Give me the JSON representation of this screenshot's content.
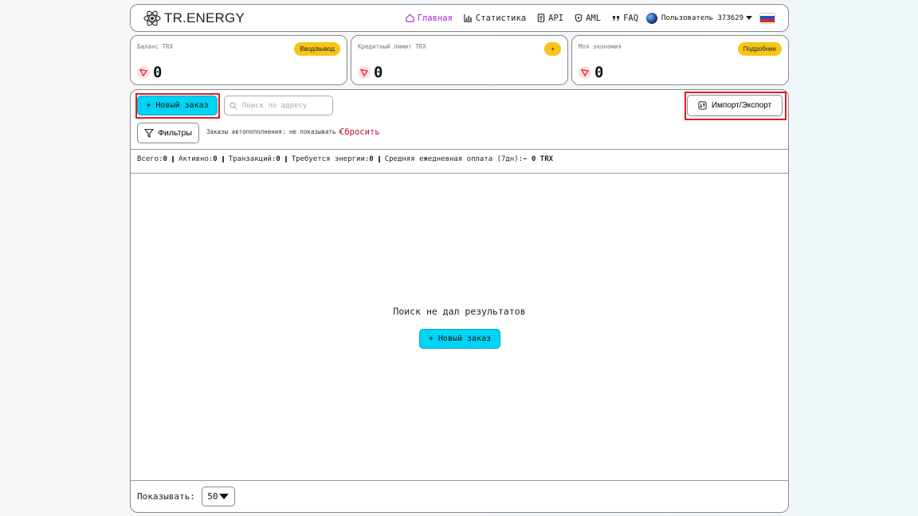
{
  "header": {
    "logo_text": "TR.ENERGY",
    "nav": [
      {
        "label": "Главная",
        "icon": "home-icon",
        "active": true
      },
      {
        "label": "Статистика",
        "icon": "bar-chart-icon",
        "active": false
      },
      {
        "label": "API",
        "icon": "document-icon",
        "active": false
      },
      {
        "label": "AML",
        "icon": "shield-icon",
        "active": false
      },
      {
        "label": "FAQ",
        "icon": "quote-icon",
        "active": false
      }
    ],
    "user_label": "Пользователь 373629",
    "language": "ru",
    "active_color": "#a623d8"
  },
  "cards": [
    {
      "label": "Баланс TRX",
      "button": "Ввод/вывод",
      "value": "0"
    },
    {
      "label": "Кредитный лимит TRX",
      "button": "+",
      "value": "0"
    },
    {
      "label": "Моя экономия",
      "button": "Подробнее",
      "value": "0"
    }
  ],
  "toolbar": {
    "new_order_label": "+ Новый заказ",
    "search_placeholder": "Поиск по адресу",
    "import_export_label": "Импорт/Экспорт",
    "filters_label": "Фильтры",
    "filter_tag": "Заказы автопополнения: не показывать",
    "filter_tag_close": "×",
    "reset_label": "Сбросить"
  },
  "stats": {
    "total_label": "Всего:",
    "total_value": "0",
    "active_label": "Активно:",
    "active_value": "0",
    "tx_label": "Транзакций:",
    "tx_value": "0",
    "energy_label": "Требуется энергии:",
    "energy_value": "0",
    "avg_label": "Средняя ежедневная оплата (7дн):",
    "avg_value": "~ 0 TRX"
  },
  "empty": {
    "message": "Поиск не дал результатов",
    "button_label": "+ Новый заказ"
  },
  "footer": {
    "show_label": "Показывать:",
    "per_page": "50"
  },
  "colors": {
    "accent_cyan": "#00d4f5",
    "card_button_yellow": "#f5c518",
    "reset_red": "#c8102e",
    "highlight_red": "#e01b24"
  }
}
